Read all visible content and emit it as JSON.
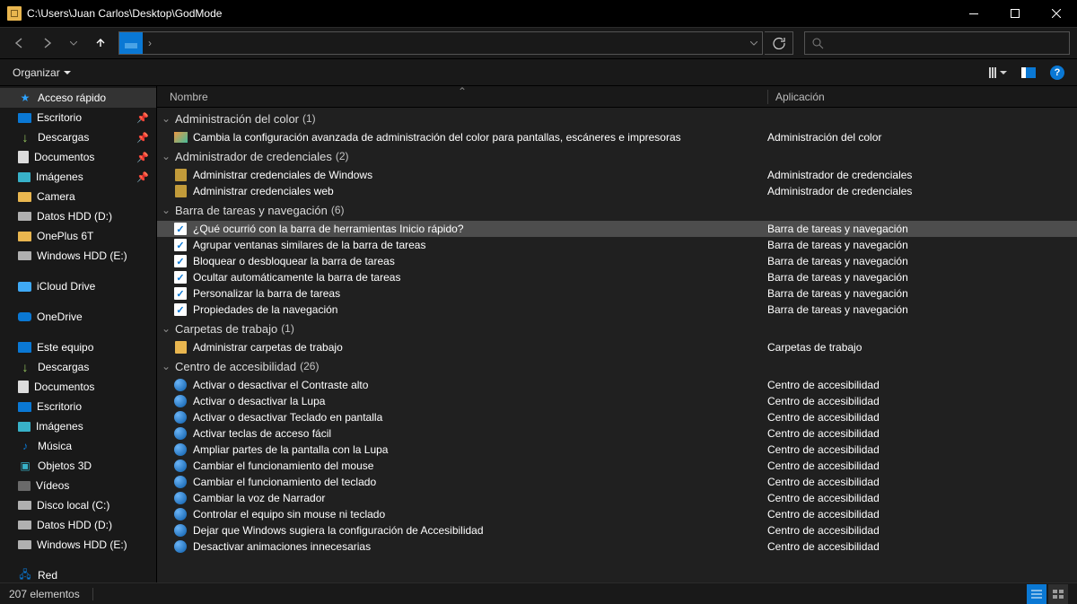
{
  "window_title": "C:\\Users\\Juan Carlos\\Desktop\\GodMode",
  "path_crumb": "",
  "search_placeholder": "",
  "organize_label": "Organizar",
  "columns": {
    "name": "Nombre",
    "app": "Aplicación"
  },
  "status": {
    "count": "207 elementos"
  },
  "tree": [
    {
      "label": "Acceso rápido",
      "icon": "ic-star",
      "selected": true
    },
    {
      "label": "Escritorio",
      "icon": "ic-desktop",
      "pin": true
    },
    {
      "label": "Descargas",
      "icon": "ic-downloads",
      "pin": true
    },
    {
      "label": "Documentos",
      "icon": "ic-docs",
      "pin": true
    },
    {
      "label": "Imágenes",
      "icon": "ic-images",
      "pin": true
    },
    {
      "label": "Camera",
      "icon": "ic-folder"
    },
    {
      "label": "Datos HDD (D:)",
      "icon": "ic-drive"
    },
    {
      "label": "OnePlus 6T",
      "icon": "ic-folder"
    },
    {
      "label": "Windows HDD (E:)",
      "icon": "ic-drive"
    },
    {
      "spacer": true
    },
    {
      "label": "iCloud Drive",
      "icon": "ic-icloud"
    },
    {
      "spacer": true
    },
    {
      "label": "OneDrive",
      "icon": "ic-onedrive"
    },
    {
      "spacer": true
    },
    {
      "label": "Este equipo",
      "icon": "ic-pc"
    },
    {
      "label": "Descargas",
      "icon": "ic-downloads"
    },
    {
      "label": "Documentos",
      "icon": "ic-docs"
    },
    {
      "label": "Escritorio",
      "icon": "ic-desktop"
    },
    {
      "label": "Imágenes",
      "icon": "ic-images"
    },
    {
      "label": "Música",
      "icon": "ic-music",
      "glyph": "♪"
    },
    {
      "label": "Objetos 3D",
      "icon": "ic-objects",
      "glyph": "▣"
    },
    {
      "label": "Vídeos",
      "icon": "ic-videos"
    },
    {
      "label": "Disco local (C:)",
      "icon": "ic-osd"
    },
    {
      "label": "Datos HDD (D:)",
      "icon": "ic-drive"
    },
    {
      "label": "Windows HDD (E:)",
      "icon": "ic-drive"
    },
    {
      "spacer": true
    },
    {
      "label": "Red",
      "icon": "ic-net",
      "glyph": "🖧"
    }
  ],
  "groups": [
    {
      "name": "Administración del color",
      "count": 1,
      "items": [
        {
          "icon": "ric-color",
          "name": "Cambia la configuración avanzada de administración del color para pantallas, escáneres e impresoras",
          "app": "Administración del color"
        }
      ]
    },
    {
      "name": "Administrador de credenciales",
      "count": 2,
      "items": [
        {
          "icon": "ric-cred",
          "name": "Administrar credenciales de Windows",
          "app": "Administrador de credenciales"
        },
        {
          "icon": "ric-cred",
          "name": "Administrar credenciales web",
          "app": "Administrador de credenciales"
        }
      ]
    },
    {
      "name": "Barra de tareas y navegación",
      "count": 6,
      "items": [
        {
          "icon": "ric-tb",
          "name": "¿Qué ocurrió con la barra de herramientas Inicio rápido?",
          "app": "Barra de tareas y navegación",
          "hover": true
        },
        {
          "icon": "ric-tb",
          "name": "Agrupar ventanas similares de la barra de tareas",
          "app": "Barra de tareas y navegación"
        },
        {
          "icon": "ric-tb",
          "name": "Bloquear o desbloquear la barra de tareas",
          "app": "Barra de tareas y navegación"
        },
        {
          "icon": "ric-tb",
          "name": "Ocultar automáticamente la barra de tareas",
          "app": "Barra de tareas y navegación"
        },
        {
          "icon": "ric-tb",
          "name": "Personalizar la barra de tareas",
          "app": "Barra de tareas y navegación"
        },
        {
          "icon": "ric-tb",
          "name": "Propiedades de la navegación",
          "app": "Barra de tareas y navegación"
        }
      ]
    },
    {
      "name": "Carpetas de trabajo",
      "count": 1,
      "items": [
        {
          "icon": "ric-wf",
          "name": "Administrar carpetas de trabajo",
          "app": "Carpetas de trabajo"
        }
      ]
    },
    {
      "name": "Centro de accesibilidad",
      "count": 26,
      "items": [
        {
          "icon": "ric-ease",
          "name": "Activar o desactivar el Contraste alto",
          "app": "Centro de accesibilidad"
        },
        {
          "icon": "ric-ease",
          "name": "Activar o desactivar la Lupa",
          "app": "Centro de accesibilidad"
        },
        {
          "icon": "ric-ease",
          "name": "Activar o desactivar Teclado en pantalla",
          "app": "Centro de accesibilidad"
        },
        {
          "icon": "ric-ease",
          "name": "Activar teclas de acceso fácil",
          "app": "Centro de accesibilidad"
        },
        {
          "icon": "ric-ease",
          "name": "Ampliar partes de la pantalla con la Lupa",
          "app": "Centro de accesibilidad"
        },
        {
          "icon": "ric-ease",
          "name": "Cambiar el funcionamiento del mouse",
          "app": "Centro de accesibilidad"
        },
        {
          "icon": "ric-ease",
          "name": "Cambiar el funcionamiento del teclado",
          "app": "Centro de accesibilidad"
        },
        {
          "icon": "ric-ease",
          "name": "Cambiar la voz de Narrador",
          "app": "Centro de accesibilidad"
        },
        {
          "icon": "ric-ease",
          "name": "Controlar el equipo sin mouse ni teclado",
          "app": "Centro de accesibilidad"
        },
        {
          "icon": "ric-ease",
          "name": "Dejar que Windows sugiera la configuración de Accesibilidad",
          "app": "Centro de accesibilidad"
        },
        {
          "icon": "ric-ease",
          "name": "Desactivar animaciones innecesarias",
          "app": "Centro de accesibilidad"
        }
      ]
    }
  ]
}
